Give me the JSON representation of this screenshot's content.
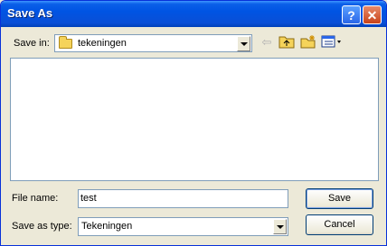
{
  "window": {
    "title": "Save As"
  },
  "titlebar": {
    "help_label": "?",
    "close_label": "✕"
  },
  "location": {
    "label": "Save in:",
    "value": "tekeningen",
    "icons": [
      "folder-icon",
      "back-arrow-icon",
      "up-folder-icon",
      "new-folder-icon",
      "view-menu-icon"
    ]
  },
  "file_list": {
    "items": []
  },
  "file_name": {
    "label": "File name:",
    "value": "test"
  },
  "save_type": {
    "label": "Save as type:",
    "value": "Tekeningen"
  },
  "buttons": {
    "save": "Save",
    "cancel": "Cancel"
  }
}
